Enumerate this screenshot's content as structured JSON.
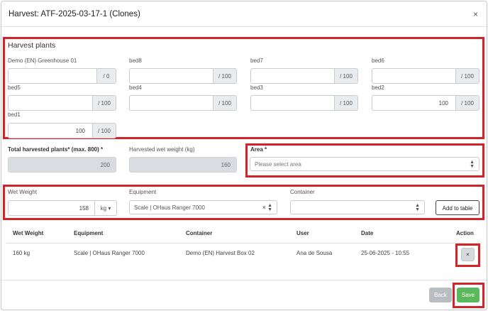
{
  "dialog": {
    "title": "Harvest: ATF-2025-03-17-1 (Clones)",
    "close_glyph": "×"
  },
  "harvest_plants": {
    "heading": "Harvest plants",
    "beds": [
      {
        "label": "Demo (EN) Greenhouse 01",
        "value": "",
        "max": "/ 0"
      },
      {
        "label": "bed8",
        "value": "",
        "max": "/ 100"
      },
      {
        "label": "bed7",
        "value": "",
        "max": "/ 100"
      },
      {
        "label": "bed6",
        "value": "",
        "max": "/ 100"
      },
      {
        "label": "bed5",
        "value": "",
        "max": "/ 100"
      },
      {
        "label": "bed4",
        "value": "",
        "max": "/ 100"
      },
      {
        "label": "bed3",
        "value": "",
        "max": "/ 100"
      },
      {
        "label": "bed2",
        "value": "100",
        "max": "/ 100"
      },
      {
        "label": "bed1",
        "value": "100",
        "max": "/ 100"
      }
    ]
  },
  "totals": {
    "total_label": "Total harvested plants* (max. 800) *",
    "total_value": "200",
    "wet_label": "Harvested wet weight (kg)",
    "wet_value": "160",
    "area_label": "Area *",
    "area_placeholder": "Please select area"
  },
  "entry": {
    "wet_weight_label": "Wet Weight",
    "wet_weight_value": "158",
    "unit": "kg",
    "equipment_label": "Equipment",
    "equipment_value": "Scale | OHaus Ranger 7000",
    "container_label": "Container",
    "container_value": "",
    "add_button": "Add to table"
  },
  "table": {
    "headers": [
      "Wet Weight",
      "Equipment",
      "Container",
      "User",
      "Date",
      "Action"
    ],
    "rows": [
      {
        "wet_weight": "160 kg",
        "equipment": "Scale | OHaus Ranger 7000",
        "container": "Demo (EN) Harvest Box 02",
        "user": "Ana de Sousa",
        "date": "25-06-2025 - 10:55",
        "action": "×"
      }
    ]
  },
  "footer": {
    "back": "Back",
    "save": "Save"
  },
  "colors": {
    "highlight": "#d2232a",
    "save": "#5cb85c",
    "back": "#b9bec3"
  }
}
